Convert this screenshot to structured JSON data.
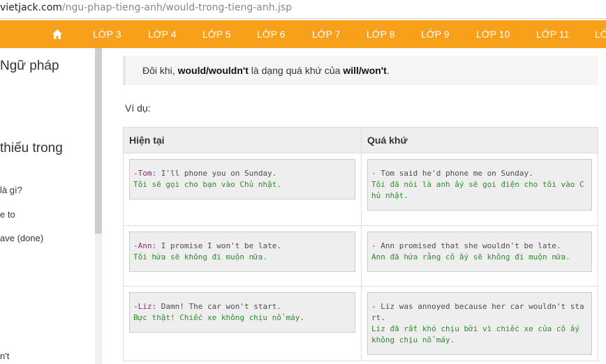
{
  "browser": {
    "url_host": "vietjack.com",
    "url_path": "/ngu-phap-tieng-anh/would-trong-tieng-anh.jsp"
  },
  "nav": {
    "home_icon": "home-icon",
    "items": [
      "LỚP 3",
      "LỚP 4",
      "LỚP 5",
      "LỚP 6",
      "LỚP 7",
      "LỚP 8",
      "LỚP 9",
      "LỚP 10",
      "LỚP 11",
      "LỚ"
    ]
  },
  "sidebar": {
    "heading1": "Ngữ pháp",
    "heading2": "thiếu trong",
    "links": [
      "là gì?",
      "e to",
      "ave (done)",
      "n't"
    ]
  },
  "content": {
    "note_prefix": "Đôi khi, ",
    "note_bold1": "would/wouldn't",
    "note_mid": " là dạng quá khứ của ",
    "note_bold2": "will/won't",
    "note_suffix": ".",
    "example_label": "Ví dụ:",
    "table": {
      "headers": [
        "Hiện tại",
        "Quá khứ"
      ],
      "rows": [
        {
          "present": {
            "speaker": "-Tom:",
            "line1_rest": " I'll phone you on Sunday.",
            "line2": "Tôi sẽ gọi cho bạn vào Chủ nhật."
          },
          "past": {
            "line1": "- Tom said he'd phone me on Sunday.",
            "line2": "Tôi đã nói là anh ấy sẽ gọi điện cho tôi vào Chủ nhật."
          }
        },
        {
          "present": {
            "speaker": "-Ann:",
            "line1_rest": " I promise I won't be late.",
            "line2": "Tôi hứa sẽ không đi muộn nữa."
          },
          "past": {
            "line1": "- Ann promised that she wouldn't be late.",
            "line2": "Ann đã hứa rằng cô ấy sẽ không đi muộn nữa."
          }
        },
        {
          "present": {
            "speaker": "-Liz:",
            "line1_rest": " Damn! The car won't start.",
            "line2": "Bực thật! Chiếc xe không chịu nổ máy."
          },
          "past": {
            "line1": "- Liz was annoyed because her car wouldn't start.",
            "line2": "Liz đã rất khó chịu bởi vì chiếc xe của cô ấy không chịu nổ máy."
          }
        }
      ]
    }
  },
  "colors": {
    "nav_bg": "#f9a01b",
    "code_text": "#4c4c4c",
    "code_green": "#2e8b2e"
  }
}
